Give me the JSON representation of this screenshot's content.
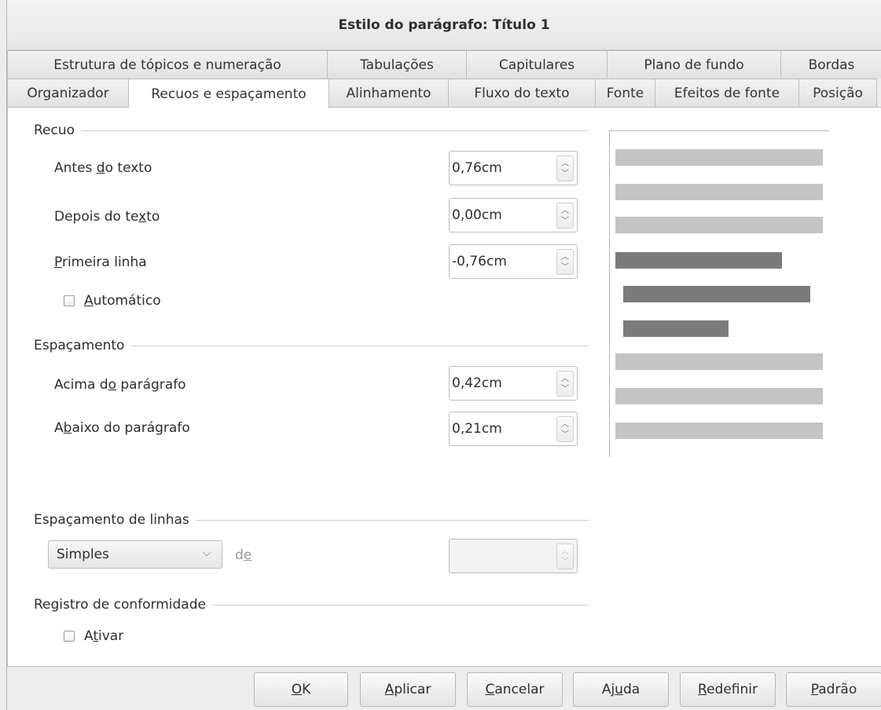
{
  "window": {
    "title": "Estilo do parágrafo: Título 1"
  },
  "tabs_top": [
    "Estrutura de tópicos e numeração",
    "Tabulações",
    "Capitulares",
    "Plano de fundo",
    "Bordas"
  ],
  "tabs_bottom": [
    "Organizador",
    "Recuos e espaçamento",
    "Alinhamento",
    "Fluxo do texto",
    "Fonte",
    "Efeitos de fonte",
    "Posição"
  ],
  "active_tab": "Recuos e espaçamento",
  "indent": {
    "header": "Recuo",
    "before_label": "Antes do texto",
    "before_value": "0,76cm",
    "after_label": "Depois do texto",
    "after_value": "0,00cm",
    "first_label": "Primeira linha",
    "first_value": "-0,76cm",
    "auto_label": "Automático",
    "auto_checked": false
  },
  "spacing": {
    "header": "Espaçamento",
    "above_label": "Acima do parágrafo",
    "above_value": "0,42cm",
    "below_label": "Abaixo do parágrafo",
    "below_value": "0,21cm"
  },
  "line_spacing": {
    "header": "Espaçamento de linhas",
    "selected": "Simples",
    "of_label": "de",
    "of_value": ""
  },
  "register": {
    "header": "Registro de conformidade",
    "activate_label": "Ativar",
    "activate_checked": false
  },
  "preview_colors": {
    "light": "#c4c4c4",
    "dark": "#7b7b7b"
  },
  "buttons": [
    "OK",
    "Aplicar",
    "Cancelar",
    "Ajuda",
    "Redefinir",
    "Padrão"
  ]
}
